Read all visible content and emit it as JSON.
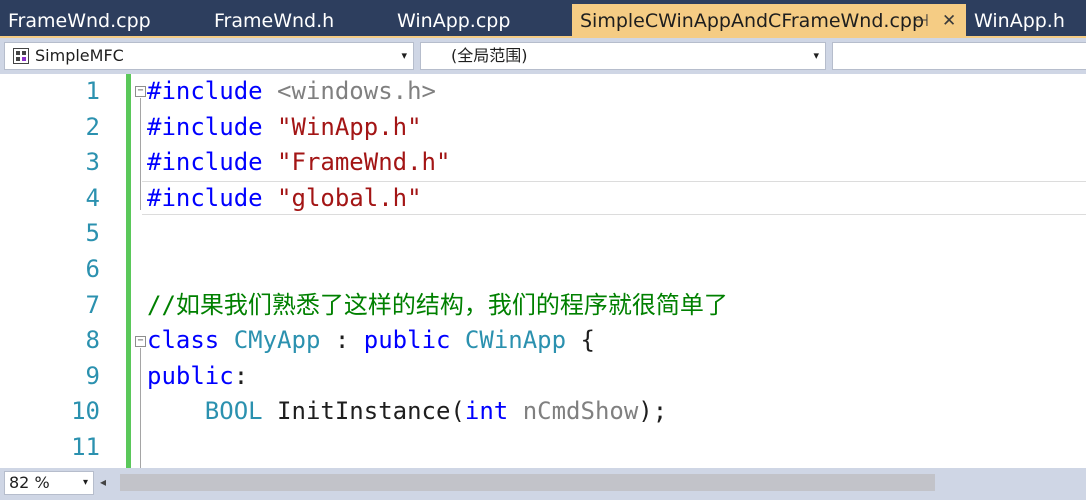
{
  "tabs": [
    {
      "label": "FrameWnd.cpp",
      "active": false
    },
    {
      "label": "FrameWnd.h",
      "active": false
    },
    {
      "label": "WinApp.cpp",
      "active": false
    },
    {
      "label": "SimpleCWinAppAndCFrameWnd.cpp",
      "active": true
    },
    {
      "label": "WinApp.h",
      "active": false
    }
  ],
  "tab_pin_glyph": "⊣",
  "tab_close_glyph": "✕",
  "nav": {
    "project": "SimpleMFC",
    "scope": "(全局范围)",
    "member": "",
    "dropdown_glyph": "▾"
  },
  "editor": {
    "line_numbers": [
      "1",
      "2",
      "3",
      "4",
      "5",
      "6",
      "7",
      "8",
      "9",
      "10",
      "11"
    ],
    "lines": {
      "l1": {
        "kw": "#include",
        "rest": " <windows.h>"
      },
      "l2": {
        "kw": "#include",
        "rest": " \"WinApp.h\""
      },
      "l3": {
        "kw": "#include",
        "rest": " \"FrameWnd.h\""
      },
      "l4": {
        "kw": "#include",
        "rest": " \"global.h\""
      },
      "l7": {
        "comment": "//如果我们熟悉了这样的结构，我们的程序就很简单了"
      },
      "l8": {
        "kw1": "class",
        "type1": " CMyApp",
        "sep": " : ",
        "kw2": "public",
        "type2": " CWinApp",
        "brace": " {"
      },
      "l9": {
        "kw": "public",
        "punct": ":"
      },
      "l10": {
        "indent": "    ",
        "type": "BOOL",
        "fn": " InitInstance(",
        "kw": "int",
        "param": " nCmdShow",
        "end": ");"
      }
    },
    "fold_glyph": "−"
  },
  "status": {
    "zoom": "82 %",
    "scroll_left_glyph": "◂"
  },
  "colors": {
    "tab_bar": "#2d3e5e",
    "active_tab": "#f5cc84",
    "keyword": "#0000ff",
    "string": "#a31515",
    "comment": "#008000",
    "type": "#2b91af",
    "change_bar": "#5ac85a"
  }
}
